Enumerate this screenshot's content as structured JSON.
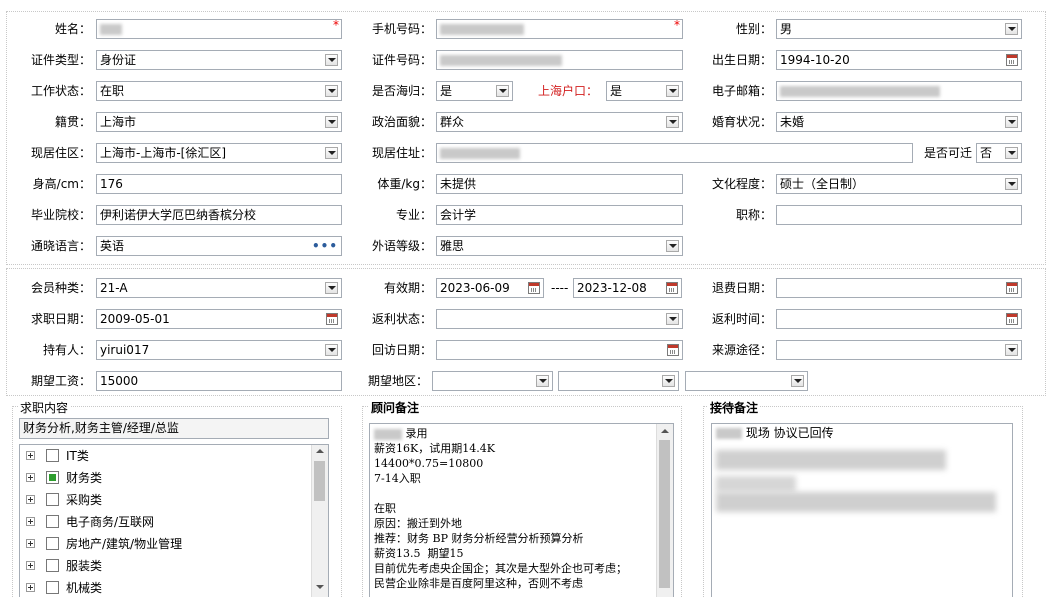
{
  "form1": {
    "name_label": "姓名：",
    "name_value": "",
    "phone_label": "手机号码：",
    "gender_label": "性别：",
    "gender_value": "男",
    "idtype_label": "证件类型：",
    "idtype_value": "身份证",
    "idno_label": "证件号码：",
    "birth_label": "出生日期：",
    "birth_value": "1994-10-20",
    "work_label": "工作状态：",
    "work_value": "在职",
    "returnee_label": "是否海归：",
    "returnee_value": "是",
    "hukou_label": "上海户口：",
    "hukou_value": "是",
    "email_label": "电子邮箱：",
    "native_label": "籍贯：",
    "native_value": "上海市",
    "political_label": "政治面貌：",
    "political_value": "群众",
    "marital_label": "婚育状况：",
    "marital_value": "未婚",
    "residence_label": "现居住区：",
    "residence_value": "上海市-上海市-[徐汇区]",
    "address_label": "现居住址：",
    "relocate_label": "是否可迁",
    "relocate_value": "否",
    "height_label": "身高/cm：",
    "height_value": "176",
    "weight_label": "体重/kg：",
    "weight_value": "未提供",
    "edu_label": "文化程度：",
    "edu_value": "硕士（全日制）",
    "school_label": "毕业院校：",
    "school_value": "伊利诺伊大学厄巴纳香槟分校",
    "major_label": "专业：",
    "major_value": "会计学",
    "title_label": "职称：",
    "title_value": "",
    "lang_label": "通晓语言：",
    "lang_value": "英语",
    "lang_more": "•••",
    "langlevel_label": "外语等级：",
    "langlevel_value": "雅思"
  },
  "form2": {
    "member_label": "会员种类：",
    "member_value": "21-A",
    "valid_label": "有效期：",
    "valid_from": "2023-06-09",
    "valid_sep": "----",
    "valid_to": "2023-12-08",
    "refund_label": "退费日期：",
    "jobdate_label": "求职日期：",
    "jobdate_value": "2009-05-01",
    "rebate_label": "返利状态：",
    "rebatetime_label": "返利时间：",
    "holder_label": "持有人：",
    "holder_value": "yirui017",
    "visit_label": "回访日期：",
    "source_label": "来源途径：",
    "salary_label": "期望工资：",
    "salary_value": "15000",
    "region_label": "期望地区："
  },
  "jobs": {
    "header": "求职内容",
    "selected": "财务分析,财务主管/经理/总监",
    "tree": [
      {
        "label": "IT类",
        "checked": false
      },
      {
        "label": "财务类",
        "checked": true
      },
      {
        "label": "采购类",
        "checked": false
      },
      {
        "label": "电子商务/互联网",
        "checked": false
      },
      {
        "label": "房地产/建筑/物业管理",
        "checked": false
      },
      {
        "label": "服装类",
        "checked": false
      },
      {
        "label": "机械类",
        "checked": false
      }
    ]
  },
  "advisor": {
    "header": "顾问备注",
    "lines": [
      "录用",
      "薪资16K，试用期14.4K",
      "14400*0.75=10800",
      "7-14入职",
      "",
      "在职",
      "原因：搬迁到外地",
      "推荐：财务 BP 财务分析经营分析预算分析",
      "薪资13.5  期望15",
      "目前优先考虑央企国企；其次是大型外企也可考虑；",
      "民营企业除非是百度阿里这种，否则不考虑"
    ]
  },
  "reception": {
    "header": "接待备注",
    "first_line": "现场 协议已回传"
  }
}
